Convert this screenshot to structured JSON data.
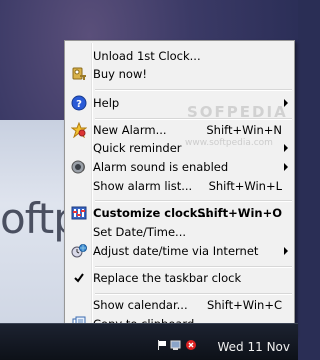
{
  "desktop": {
    "background_text": "oftp"
  },
  "menu": {
    "items": [
      {
        "label": "Unload 1st Clock...",
        "shortcut": "",
        "icon": "",
        "submenu": false
      },
      {
        "label": "Buy now!",
        "shortcut": "",
        "icon": "key-icon",
        "submenu": false
      },
      {
        "label": "Help",
        "shortcut": "",
        "icon": "help-icon",
        "submenu": true
      },
      {
        "label": "New Alarm...",
        "shortcut": "Shift+Win+N",
        "icon": "new-alarm-icon",
        "submenu": false
      },
      {
        "label": "Quick reminder",
        "shortcut": "",
        "icon": "",
        "submenu": true
      },
      {
        "label": "Alarm sound is enabled",
        "shortcut": "",
        "icon": "speaker-icon",
        "submenu": true
      },
      {
        "label": "Show alarm list...",
        "shortcut": "Shift+Win+L",
        "icon": "",
        "submenu": false
      },
      {
        "label": "Customize clock...",
        "shortcut": "Shift+Win+O",
        "icon": "customize-icon",
        "submenu": false
      },
      {
        "label": "Set Date/Time...",
        "shortcut": "",
        "icon": "",
        "submenu": false
      },
      {
        "label": "Adjust date/time via Internet",
        "shortcut": "",
        "icon": "internet-time-icon",
        "submenu": true
      },
      {
        "label": "Replace the taskbar clock",
        "shortcut": "",
        "icon": "checkmark-icon",
        "submenu": false
      },
      {
        "label": "Show calendar...",
        "shortcut": "Shift+Win+C",
        "icon": "",
        "submenu": false
      },
      {
        "label": "Copy to clipboard",
        "shortcut": "",
        "icon": "clipboard-icon",
        "submenu": false
      }
    ]
  },
  "watermark": {
    "text": "SOFPEDIA",
    "subtext": "www.softpedia.com"
  },
  "taskbar": {
    "date": "Wed 11 Nov"
  },
  "colors": {
    "menu_bg": "#f1f1f1",
    "desktop_bg": "#2c2f58",
    "taskbar_bg": "#0d1118"
  }
}
